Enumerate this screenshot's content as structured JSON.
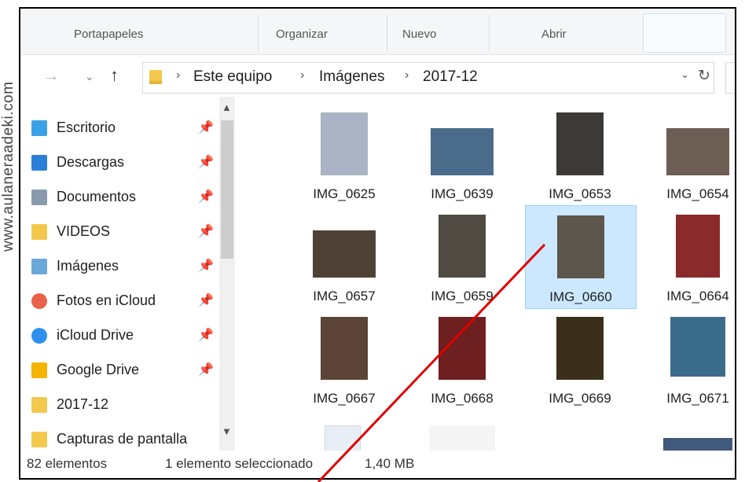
{
  "watermark": "www.aulaneraadeki.com",
  "ribbon": {
    "groups": [
      "Portapapeles",
      "Organizar",
      "Nuevo",
      "Abrir"
    ]
  },
  "address": {
    "path": [
      "Este equipo",
      "Imágenes",
      "2017-12"
    ]
  },
  "sidebar": {
    "items": [
      {
        "label": "Escritorio",
        "icon": "desktop-icon",
        "color": "#3aa0e6"
      },
      {
        "label": "Descargas",
        "icon": "download-icon",
        "color": "#2b7fd8"
      },
      {
        "label": "Documentos",
        "icon": "document-icon",
        "color": "#8a9bb0"
      },
      {
        "label": "VIDEOS",
        "icon": "folder-icon",
        "color": "#f2c94c"
      },
      {
        "label": "Imágenes",
        "icon": "pictures-icon",
        "color": "#6aa7d9"
      },
      {
        "label": "Fotos en iCloud",
        "icon": "photos-icon",
        "color": "#e8624a"
      },
      {
        "label": "iCloud Drive",
        "icon": "cloud-icon",
        "color": "#2e8ff0"
      },
      {
        "label": "Google Drive",
        "icon": "google-drive-icon",
        "color": "#f4b400"
      },
      {
        "label": "2017-12",
        "icon": "folder-icon",
        "color": "#f2c94c"
      },
      {
        "label": "Capturas de pantalla",
        "icon": "folder-icon",
        "color": "#f2c94c"
      }
    ]
  },
  "files": [
    {
      "name": "IMG_0625",
      "color": "#aab4c4"
    },
    {
      "name": "IMG_0639",
      "color": "#4a6c8a"
    },
    {
      "name": "IMG_0653",
      "color": "#3b3a38"
    },
    {
      "name": "IMG_0654",
      "color": "#6d5f55"
    },
    {
      "name": "IMG_0657",
      "color": "#4e4236"
    },
    {
      "name": "IMG_0659",
      "color": "#4f4a42"
    },
    {
      "name": "IMG_0660",
      "color": "#5d564d",
      "selected": true
    },
    {
      "name": "IMG_0664",
      "color": "#8b2a2a"
    },
    {
      "name": "IMG_0667",
      "color": "#5c4538"
    },
    {
      "name": "IMG_0668",
      "color": "#6e1f1f"
    },
    {
      "name": "IMG_0669",
      "color": "#3a2f1a"
    },
    {
      "name": "IMG_0671",
      "color": "#3c6c8c"
    }
  ],
  "status": {
    "count": "82 elementos",
    "selection": "1 elemento seleccionado",
    "size": "1,40 MB"
  }
}
